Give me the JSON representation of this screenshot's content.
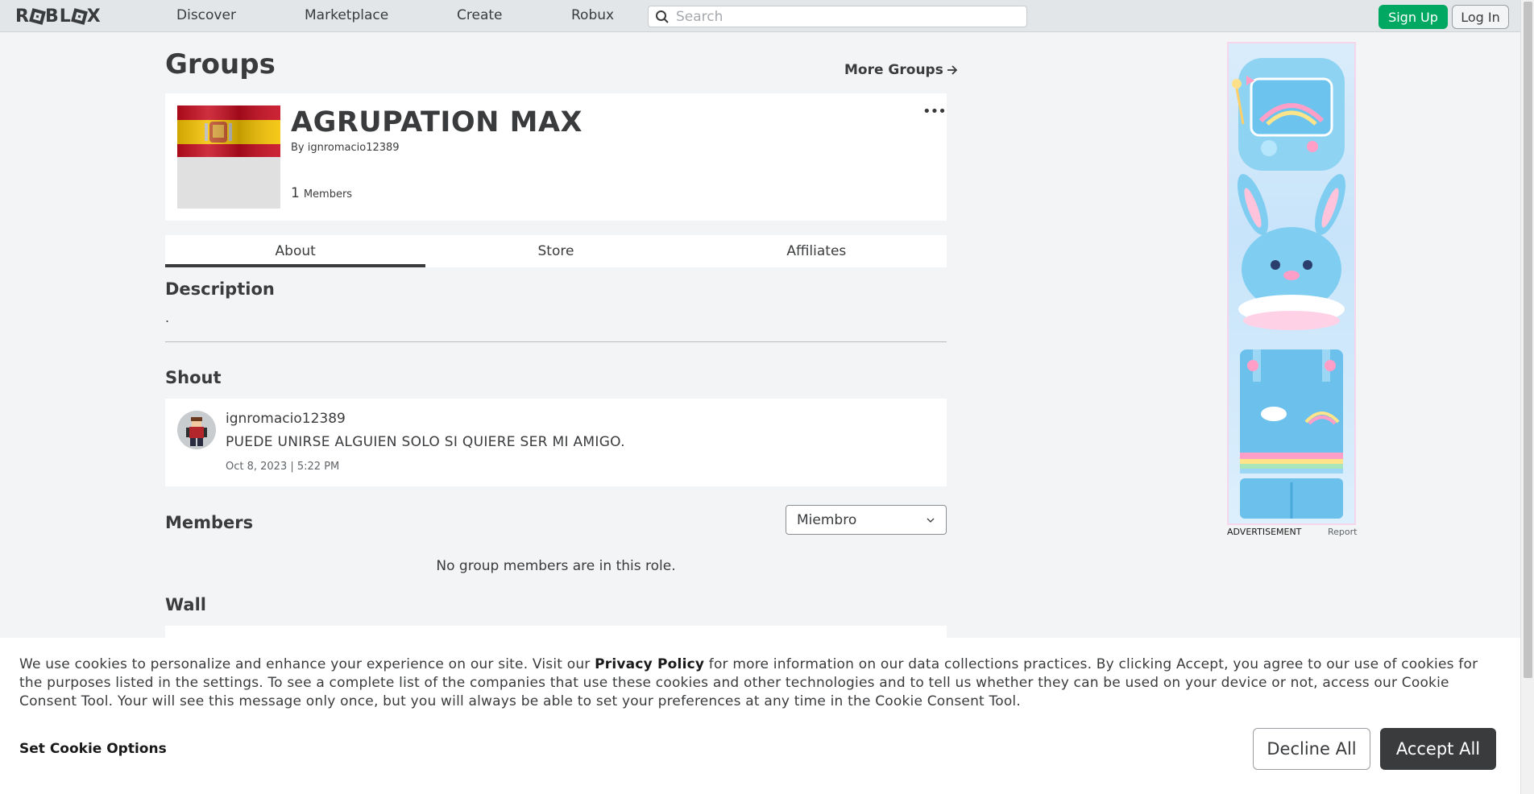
{
  "nav": {
    "logo_parts": [
      "R",
      "BL",
      "X"
    ],
    "links": [
      "Discover",
      "Marketplace",
      "Create",
      "Robux"
    ],
    "search_placeholder": "Search",
    "signup_label": "Sign Up",
    "login_label": "Log In"
  },
  "page": {
    "title": "Groups",
    "more_groups": "More Groups"
  },
  "group": {
    "name": "AGRUPATION MAX",
    "by_label": "By",
    "owner": "ignromacio12389",
    "member_count": "1",
    "members_label": "Members",
    "more_label": "•••"
  },
  "tabs": [
    "About",
    "Store",
    "Affiliates"
  ],
  "description": {
    "heading": "Description",
    "text": "."
  },
  "shout": {
    "heading": "Shout",
    "user": "ignromacio12389",
    "body": "PUEDE UNIRSE ALGUIEN SOLO SI QUIERE SER MI AMIGO.",
    "date": "Oct 8, 2023 | 5:22 PM"
  },
  "members": {
    "heading": "Members",
    "role_selected": "Miembro",
    "empty_text": "No group members are in this role."
  },
  "wall": {
    "heading": "Wall"
  },
  "ad": {
    "label": "ADVERTISEMENT",
    "report": "Report"
  },
  "cookie": {
    "text_before": "We use cookies to personalize and enhance your experience on our site. Visit our ",
    "link": "Privacy Policy",
    "text_after": " for more information on our data collections practices. By clicking Accept, you agree to our use of cookies for the purposes listed in the settings. To see a complete list of the companies that use these cookies and other technologies and to tell us whether they can be used on your device or not, access our Cookie Consent Tool. Your will see this message only once, but you will always be able to set your preferences at any time in the Cookie Consent Tool.",
    "options_label": "Set Cookie Options",
    "decline_label": "Decline All",
    "accept_label": "Accept All"
  },
  "colors": {
    "signup": "#00a862",
    "accept": "#393b3d",
    "page_bg": "#f2f4f5"
  }
}
